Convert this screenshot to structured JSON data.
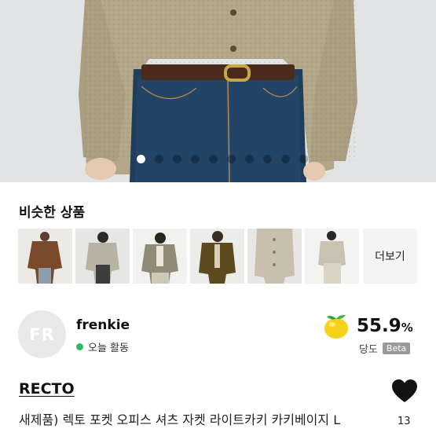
{
  "hero": {
    "carousel": {
      "total": 10,
      "active_index": 0
    }
  },
  "similar": {
    "title": "비슷한 상품",
    "thumbnails": [
      "thumb-1",
      "thumb-2",
      "thumb-3",
      "thumb-4",
      "thumb-5",
      "thumb-6"
    ],
    "more_label": "더보기"
  },
  "seller": {
    "initials": "FR",
    "name": "frenkie",
    "online_status": "오늘 활동",
    "online_color": "#2dbb6a"
  },
  "score": {
    "value": "55.9",
    "unit": "%",
    "label": "당도",
    "beta": "Beta",
    "icon": "lemon-icon"
  },
  "product": {
    "brand": "RECTO",
    "title": "새제품) 렉토 포켓 오피스 셔츠 자켓 라이트카키 카키베이지 L",
    "like_count": "13",
    "like_icon": "heart-icon"
  }
}
